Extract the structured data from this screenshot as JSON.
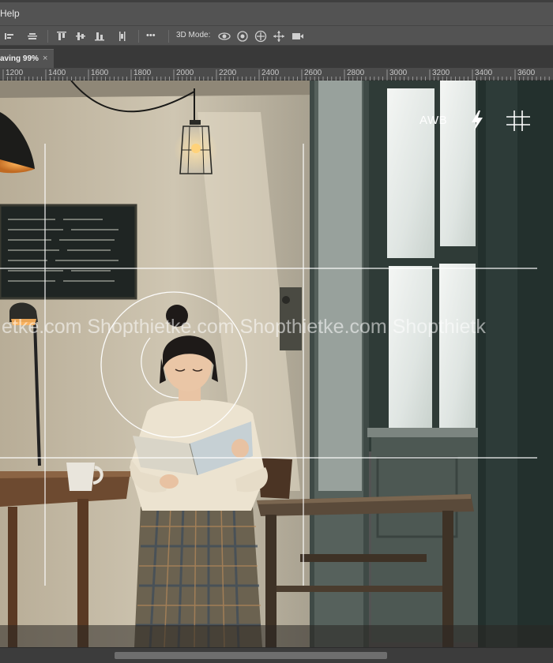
{
  "menu": {
    "help_label": "Help"
  },
  "options_bar": {
    "mode_label": "3D Mode:",
    "more_label": "•••",
    "align_icons": [
      "align-left-icon",
      "align-center-icon",
      "align-top-icon",
      "align-vcenter-icon",
      "align-bottom-icon",
      "distribute-icon"
    ],
    "mode_icons": [
      "orbit-icon",
      "roll-icon",
      "pan-icon",
      "slide-icon",
      "scale-video-icon"
    ]
  },
  "document_tab": {
    "title": "aving 99%",
    "close_label": "×"
  },
  "ruler": {
    "labels": [
      "1200",
      "1400",
      "1600",
      "1800",
      "2000",
      "2200",
      "2400",
      "2600",
      "2800",
      "3000",
      "3200",
      "3400",
      "3600"
    ]
  },
  "canvas_overlay": {
    "awb_label": "AWB",
    "flash_icon": "flash-icon",
    "grid_icon": "grid-icon",
    "watermark": "etke.com Shopthietke.com Shopthietke.com Shopthietk"
  },
  "colors": {
    "panel": "#535353",
    "tab_bar": "#393939",
    "ruler": "#4b4b4b",
    "guide": "#ffffff"
  }
}
